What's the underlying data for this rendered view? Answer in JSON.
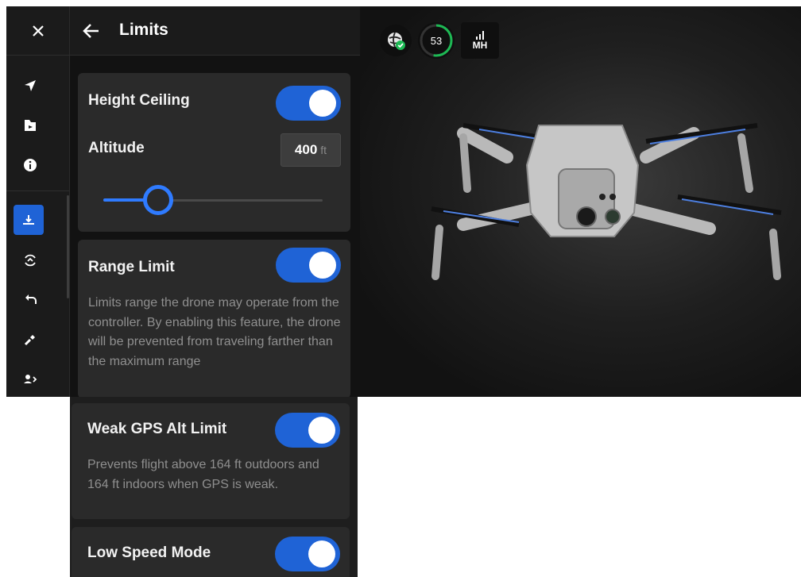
{
  "header": {
    "title": "Limits"
  },
  "status": {
    "battery": "53",
    "signal_label": "MH"
  },
  "height_ceiling": {
    "label": "Height Ceiling",
    "enabled": true,
    "altitude_label": "Altitude",
    "altitude_value": "400",
    "altitude_unit": "ft",
    "slider_fraction": 0.25
  },
  "range_limit": {
    "label": "Range Limit",
    "enabled": true,
    "description": "Limits range the drone may operate from the controller. By enabling this feature, the drone will be prevented from traveling farther than the maximum range"
  },
  "weak_gps": {
    "label": "Weak GPS Alt Limit",
    "enabled": true,
    "description": "Prevents flight above 164 ft outdoors and 164 ft indoors when GPS is weak."
  },
  "low_speed": {
    "label": "Low Speed Mode",
    "enabled": true
  },
  "rail": {
    "items": [
      "navigate-icon",
      "files-icon",
      "info-icon",
      "limits-icon",
      "landing-icon",
      "return-icon",
      "flashlight-icon",
      "user-swap-icon"
    ]
  },
  "colors": {
    "accent": "#1f63d6",
    "slider": "#2f7bff",
    "background": "#121212",
    "card": "#2a2a2a"
  }
}
